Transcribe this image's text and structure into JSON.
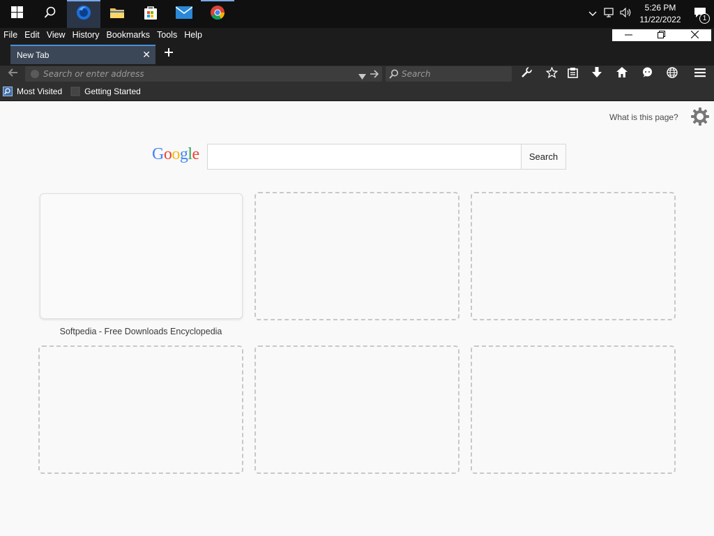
{
  "taskbar": {
    "apps": [
      {
        "name": "start",
        "icon": "windows-logo-icon"
      },
      {
        "name": "search",
        "icon": "search-icon"
      },
      {
        "name": "firefox",
        "icon": "firefox-icon"
      },
      {
        "name": "file-explorer",
        "icon": "folder-icon"
      },
      {
        "name": "store",
        "icon": "store-icon"
      },
      {
        "name": "mail",
        "icon": "mail-icon"
      },
      {
        "name": "chrome",
        "icon": "chrome-icon"
      }
    ],
    "clock": {
      "time": "5:26 PM",
      "date": "11/22/2022"
    },
    "notification_count": "1"
  },
  "menubar": {
    "items": [
      "File",
      "Edit",
      "View",
      "History",
      "Bookmarks",
      "Tools",
      "Help"
    ]
  },
  "tabs": [
    {
      "label": "New Tab",
      "active": true
    }
  ],
  "navbar": {
    "url_placeholder": "Search or enter address",
    "search_placeholder": "Search"
  },
  "bookmarks": [
    {
      "label": "Most Visited"
    },
    {
      "label": "Getting Started"
    }
  ],
  "content": {
    "what_is_link": "What is this page?",
    "google_logo": "Google",
    "google_button": "Search",
    "tiles": [
      {
        "title": "Softpedia - Free Downloads Encyclopedia",
        "filled": true
      },
      {
        "title": "",
        "filled": false
      },
      {
        "title": "",
        "filled": false
      },
      {
        "title": "",
        "filled": false
      },
      {
        "title": "",
        "filled": false
      },
      {
        "title": "",
        "filled": false
      }
    ]
  },
  "colors": {
    "taskbar_bg": "#101010",
    "chrome_bg": "#2f2f2f",
    "tab_active": "#3b4656",
    "accent": "#4a90d9",
    "page_bg": "#f9f9f9"
  }
}
